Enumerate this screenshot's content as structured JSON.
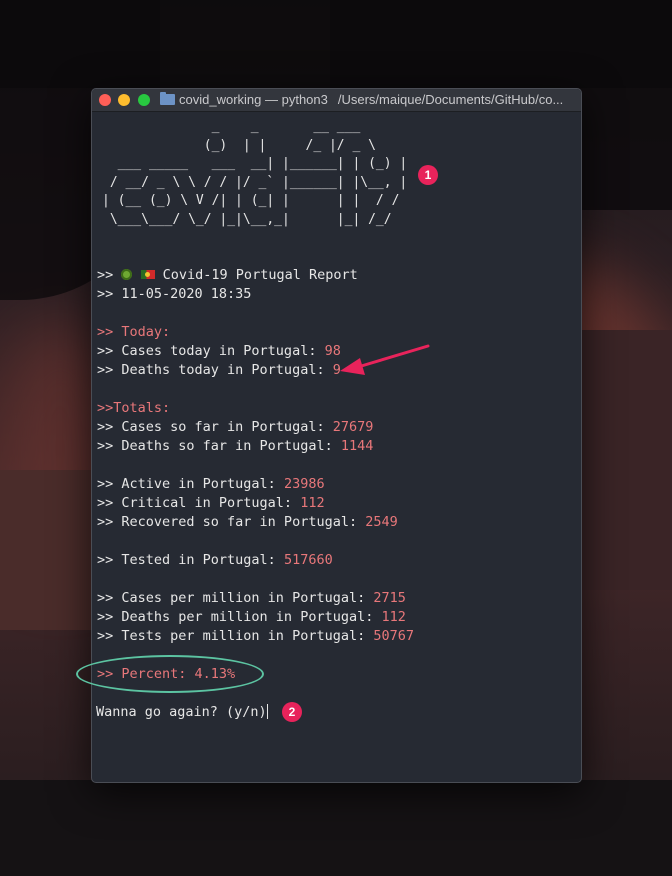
{
  "window": {
    "title": "covid_working — python3",
    "path": "/Users/maique/Documents/GitHub/co..."
  },
  "terminal": {
    "ascii_art": "              _    _       __ ___\n             (_)  | |     /_ |/ _ \\\n  ___ _____   ___  __| |______| | (_) |\n / __/ _ \\ \\ / / |/ _` |______| |\\__, |\n| (__ (_) \\ V /| | (_| |      | |  / /\n \\___\\___/ \\_/ |_|\\__,_|      |_| /_/",
    "header_report": ">> ",
    "report_title": " Covid-19 Portugal Report",
    "header_date": ">> 11-05-2020 18:35",
    "today_heading": ">> Today:",
    "cases_today_label": ">> Cases today in Portugal: ",
    "cases_today_value": "98",
    "deaths_today_label": ">> Deaths today in Portugal: ",
    "deaths_today_value": "9",
    "totals_heading": ">>Totals:",
    "cases_total_label": ">> Cases so far in Portugal: ",
    "cases_total_value": "27679",
    "deaths_total_label": ">> Deaths so far in Portugal: ",
    "deaths_total_value": "1144",
    "active_label": ">> Active in Portugal: ",
    "active_value": "23986",
    "critical_label": ">> Critical in Portugal: ",
    "critical_value": "112",
    "recovered_label": ">> Recovered so far in Portugal: ",
    "recovered_value": "2549",
    "tested_label": ">> Tested in Portugal: ",
    "tested_value": "517660",
    "cases_per_million_label": ">> Cases per million in Portugal: ",
    "cases_per_million_value": "2715",
    "deaths_per_million_label": ">> Deaths per million in Portugal: ",
    "deaths_per_million_value": "112",
    "tests_per_million_label": ">> Tests per million in Portugal: ",
    "tests_per_million_value": "50767",
    "percent_line": ">> Percent: 4.13%",
    "prompt": "Wanna go again? (y/n)"
  },
  "annotations": {
    "badge_1": "1",
    "badge_2": "2",
    "arrow_color": "#e8235b",
    "oval_color": "#5cc4a2"
  }
}
